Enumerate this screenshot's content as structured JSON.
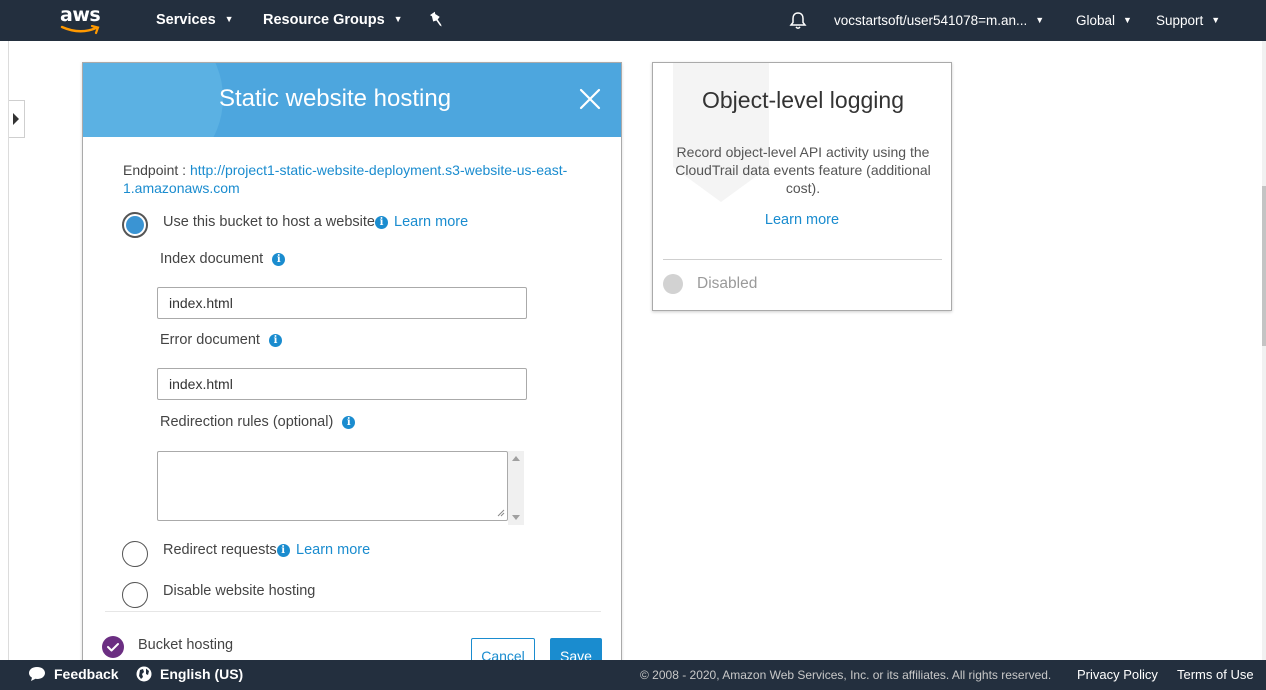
{
  "topnav": {
    "logo_text": "aws",
    "services_label": "Services",
    "resource_groups_label": "Resource Groups",
    "account_label": "vocstartsoft/user541078=m.an...",
    "region_label": "Global",
    "support_label": "Support"
  },
  "hosting_card": {
    "title": "Static website hosting",
    "endpoint_label": "Endpoint :",
    "endpoint_url": "http://project1-static-website-deployment.s3-website-us-east-1.amazonaws.com",
    "options": {
      "use_bucket_label": "Use this bucket to host a website",
      "use_bucket_learn": "Learn more",
      "redirect_label": "Redirect requests",
      "redirect_learn": "Learn more",
      "disable_label": "Disable website hosting"
    },
    "selected_option": "use_bucket",
    "index_document_label": "Index document",
    "index_document_value": "index.html",
    "error_document_label": "Error document",
    "error_document_value": "index.html",
    "redirection_rules_label": "Redirection rules (optional)",
    "redirection_rules_value": "",
    "bucket_hosting_label": "Bucket hosting",
    "cancel_label": "Cancel",
    "save_label": "Save"
  },
  "logging_card": {
    "title": "Object-level logging",
    "description": "Record object-level API activity using the CloudTrail data events feature (additional cost).",
    "learn_more": "Learn more",
    "status": "Disabled"
  },
  "footer": {
    "feedback_label": "Feedback",
    "language_label": "English (US)",
    "copyright": "© 2008 - 2020, Amazon Web Services, Inc. or its affiliates. All rights reserved.",
    "privacy_label": "Privacy Policy",
    "terms_label": "Terms of Use"
  },
  "colors": {
    "nav_bg": "#232f3e",
    "header_blue": "#4da6de",
    "link_blue": "#1a8ccf",
    "check_purple": "#6b2e82"
  }
}
